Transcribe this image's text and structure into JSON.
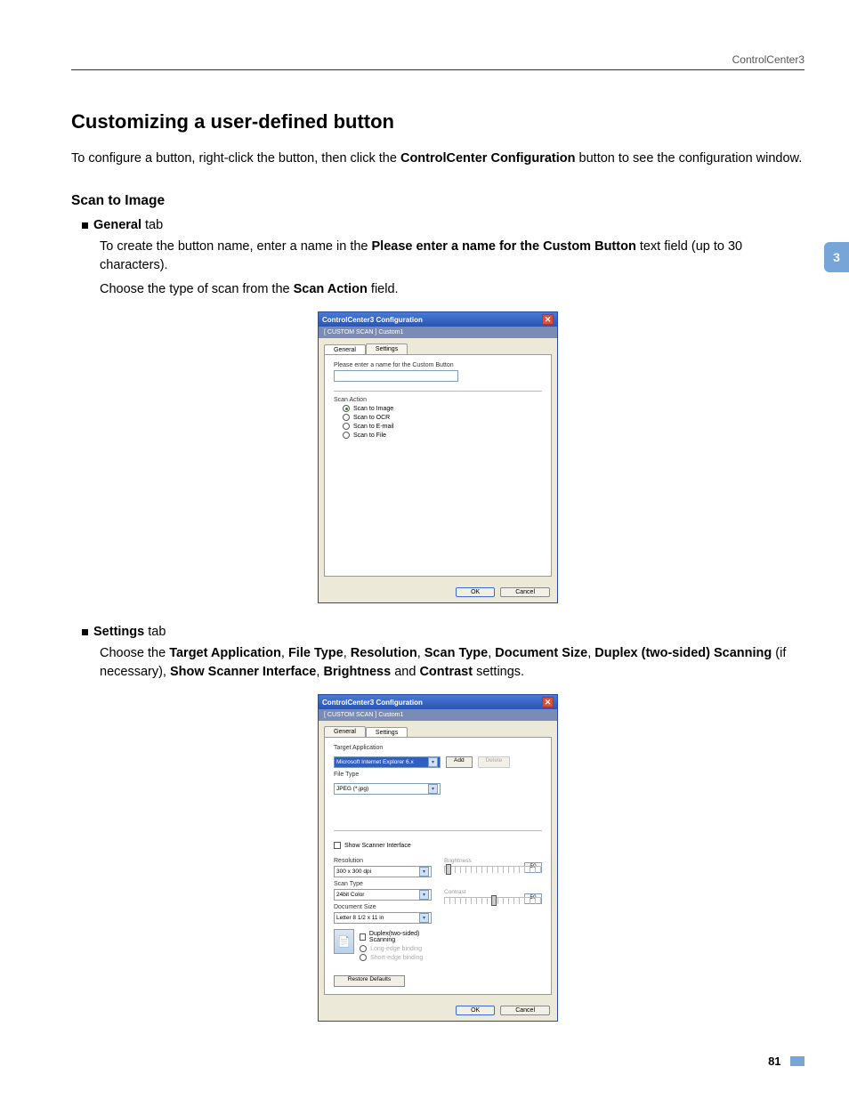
{
  "header": {
    "title": "ControlCenter3"
  },
  "side_tab": "3",
  "h1": "Customizing a user-defined button",
  "intro_parts": [
    "To configure a button, right-click the button, then click the ",
    "ControlCenter Configuration",
    " button to see the configuration window."
  ],
  "h2": "Scan to Image",
  "general_bullet_label": "General",
  "general_bullet_suffix": " tab",
  "general_body1_parts": [
    "To create the button name, enter a name in the ",
    "Please enter a name for the Custom Button",
    " text field (up to 30 characters)."
  ],
  "general_body2_parts": [
    "Choose the type of scan from the ",
    "Scan Action",
    " field."
  ],
  "settings_bullet_label": "Settings",
  "settings_bullet_suffix": " tab",
  "settings_body_parts": [
    "Choose the ",
    "Target Application",
    ", ",
    "File Type",
    ", ",
    "Resolution",
    ", ",
    "Scan Type",
    ", ",
    "Document Size",
    ", ",
    "Duplex (two-sided) Scanning",
    " (if necessary), ",
    "Show Scanner Interface",
    ", ",
    "Brightness",
    " and ",
    "Contrast",
    " settings."
  ],
  "dialog": {
    "title": "ControlCenter3 Configuration",
    "close": "✕",
    "breadcrumb": "[ CUSTOM SCAN ]  Custom1",
    "tabs": {
      "general": "General",
      "settings": "Settings"
    },
    "general_panel": {
      "name_label": "Please enter a name for the Custom Button",
      "scan_action_label": "Scan Action",
      "radios": [
        "Scan to Image",
        "Scan to OCR",
        "Scan to E-mail",
        "Scan to File"
      ]
    },
    "settings_panel": {
      "target_app_label": "Target Application",
      "target_app_value": "Microsoft Internet Explorer 6.x",
      "add": "Add",
      "delete": "Delete",
      "file_type_label": "File Type",
      "file_type_value": "JPEG (*.jpg)",
      "show_scanner": "Show Scanner Interface",
      "resolution_label": "Resolution",
      "resolution_value": "300 x 300 dpi",
      "scan_type_label": "Scan Type",
      "scan_type_value": "24bit Color",
      "doc_size_label": "Document Size",
      "doc_size_value": "Letter 8 1/2 x 11 in",
      "brightness_label": "Brightness",
      "brightness_value": "50",
      "contrast_label": "Contrast",
      "contrast_value": "50",
      "duplex": "Duplex(two-sided) Scanning",
      "long_edge": "Long-edge binding",
      "short_edge": "Short-edge binding",
      "restore": "Restore Defaults"
    },
    "ok": "OK",
    "cancel": "Cancel"
  },
  "page_number": "81"
}
